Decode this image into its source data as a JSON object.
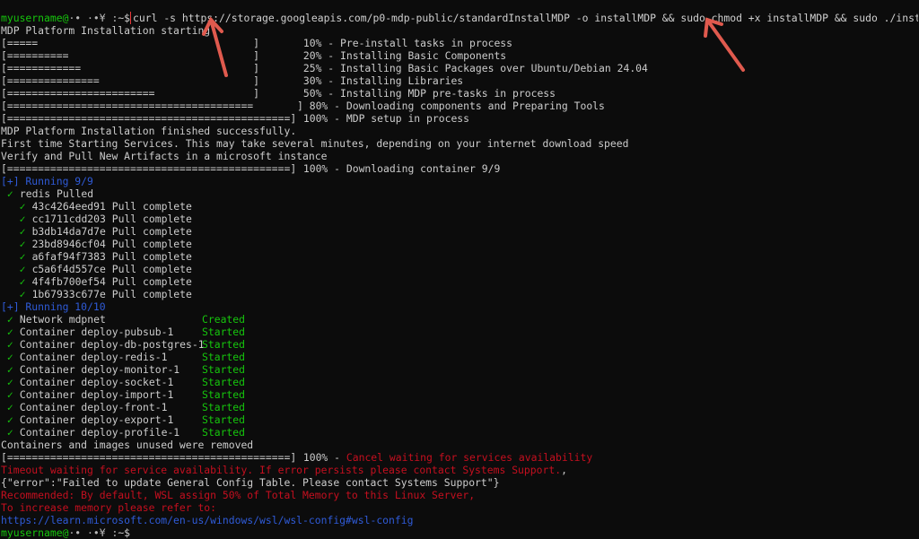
{
  "prompt": {
    "user_host": "myusername@",
    "host_glyphs": "·• ·•¥ :",
    "path_sep": "~$",
    "command": "curl -s https://storage.googleapis.com/p0-mdp-public/standardInstallMDP -o installMDP && sudo chmod +x installMDP && sudo ./installMDP"
  },
  "intro": "MDP Platform Installation starting",
  "progress": [
    {
      "bar": "[=====                                   ]",
      "text": "10% - Pre-install tasks in process"
    },
    {
      "bar": "[==========                              ]",
      "text": "20% - Installing Basic Components"
    },
    {
      "bar": "[============                            ]",
      "text": "25% - Installing Basic Packages over Ubuntu/Debian 24.04"
    },
    {
      "bar": "[===============                         ]",
      "text": "30% - Installing Libraries"
    },
    {
      "bar": "[========================                ]",
      "text": "50% - Installing MDP pre-tasks in process"
    },
    {
      "bar": "[========================================",
      "text": "] 80% - Downloading components and Preparing Tools"
    },
    {
      "bar": "[==============================================]",
      "text": "100% - MDP setup in process"
    }
  ],
  "finished": "MDP Platform Installation finished successfully.",
  "first_time": "First time Starting Services. This may take several minutes, depending on your internet download speed",
  "verify": "Verify and Pull New Artifacts in a microsoft instance",
  "download_bar": "[==============================================]",
  "download_text": "100% - Downloading container 9/9",
  "running1": "[+] Running 9/9",
  "redis_pulled": "redis Pulled",
  "pulls": [
    "43c4264eed91 Pull complete",
    "cc1711cdd203 Pull complete",
    "b3db14da7d7e Pull complete",
    "23bd8946cf04 Pull complete",
    "a6faf94f7383 Pull complete",
    "c5a6f4d557ce Pull complete",
    "4f4fb700ef54 Pull complete",
    "1b67933c677e Pull complete"
  ],
  "running2": "[+] Running 10/10",
  "containers": [
    {
      "name": "Network mdpnet",
      "status": "Created"
    },
    {
      "name": "Container deploy-pubsub-1",
      "status": "Started"
    },
    {
      "name": "Container deploy-db-postgres-1",
      "status": "Started"
    },
    {
      "name": "Container deploy-redis-1",
      "status": "Started"
    },
    {
      "name": "Container deploy-monitor-1",
      "status": "Started"
    },
    {
      "name": "Container deploy-socket-1",
      "status": "Started"
    },
    {
      "name": "Container deploy-import-1",
      "status": "Started"
    },
    {
      "name": "Container deploy-front-1",
      "status": "Started"
    },
    {
      "name": "Container deploy-export-1",
      "status": "Started"
    },
    {
      "name": "Container deploy-profile-1",
      "status": "Started"
    }
  ],
  "removed": "Containers and images unused were removed",
  "cancel_bar": "[==============================================]",
  "cancel_pct": "100% - ",
  "cancel_text": "Cancel waiting for services availability",
  "timeout_text": "Timeout waiting for service availability. If error persists please contact Systems Support.",
  "timeout_suffix": ",",
  "error_json": "{\"error\":\"Failed to update General Config Table. Please contact Systems Support\"}",
  "recommend": "Recommended: By default, WSL assign 50% of Total Memory to this Linux Server,",
  "memory": "To increase memory please refer to:",
  "link": "https://learn.microsoft.com/en-us/windows/wsl/wsl-config#wsl-config",
  "colors": {
    "green": "#16c60c",
    "red": "#c50f1f",
    "blue": "#2f5bd8",
    "arrow": "#e05a4e",
    "background": "#0c0c0c"
  },
  "icons": {
    "check": "check-icon",
    "arrow": "arrow-annotation-icon"
  }
}
